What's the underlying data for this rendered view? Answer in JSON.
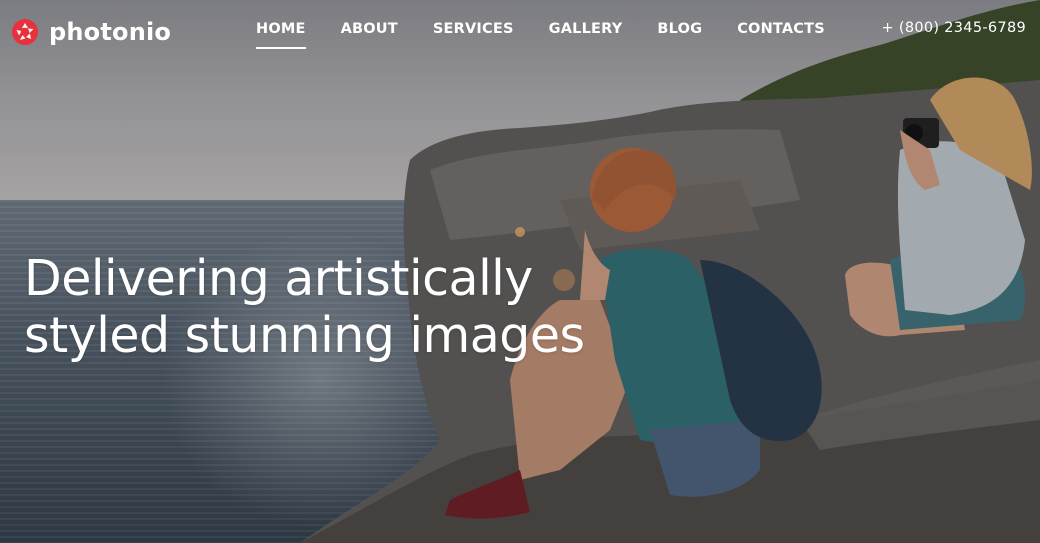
{
  "brand": {
    "name": "photonio",
    "accent_color": "#e5323e",
    "logo_icon": "camera-shutter-icon"
  },
  "nav": {
    "items": [
      {
        "label": "HOME",
        "active": true
      },
      {
        "label": "ABOUT",
        "active": false
      },
      {
        "label": "SERVICES",
        "active": false
      },
      {
        "label": "GALLERY",
        "active": false
      },
      {
        "label": "BLOG",
        "active": false
      },
      {
        "label": "CONTACTS",
        "active": false
      }
    ]
  },
  "contact": {
    "phone": "+ (800) 2345-6789"
  },
  "hero": {
    "headline_line1": "Delivering artistically",
    "headline_line2": "styled stunning images"
  }
}
